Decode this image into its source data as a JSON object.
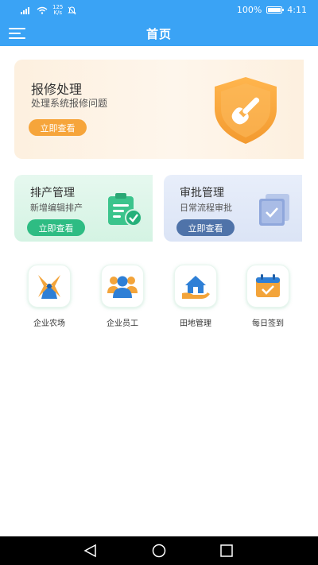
{
  "status_bar": {
    "network": "4G",
    "speed_value": "125",
    "speed_unit": "K/s",
    "battery": "100%",
    "battery_level": 1.0,
    "time": "4:11"
  },
  "nav": {
    "title": "首页",
    "menu_icon": "menu-icon"
  },
  "repair_card": {
    "title": "报修处理",
    "subtitle": "处理系统报修问题",
    "button": "立即查看",
    "icon": "shield-wrench-icon"
  },
  "cards": [
    {
      "title": "排产管理",
      "subtitle": "新增编辑排产",
      "button": "立即查看",
      "icon": "clipboard-check-icon"
    },
    {
      "title": "审批管理",
      "subtitle": "日常流程审批",
      "button": "立即查看",
      "icon": "document-check-icon"
    }
  ],
  "entries": [
    {
      "label": "企业农场",
      "icon": "windmill-icon"
    },
    {
      "label": "企业员工",
      "icon": "users-icon"
    },
    {
      "label": "田地管理",
      "icon": "house-hand-icon"
    },
    {
      "label": "每日签到",
      "icon": "calendar-check-icon"
    }
  ],
  "bottom_nav": [
    "back-icon",
    "home-icon",
    "recent-apps-icon"
  ],
  "colors": {
    "primary": "#3aa3f5",
    "orange": "#f6a53b",
    "green": "#2ebc83",
    "blue": "#4f73a9"
  }
}
